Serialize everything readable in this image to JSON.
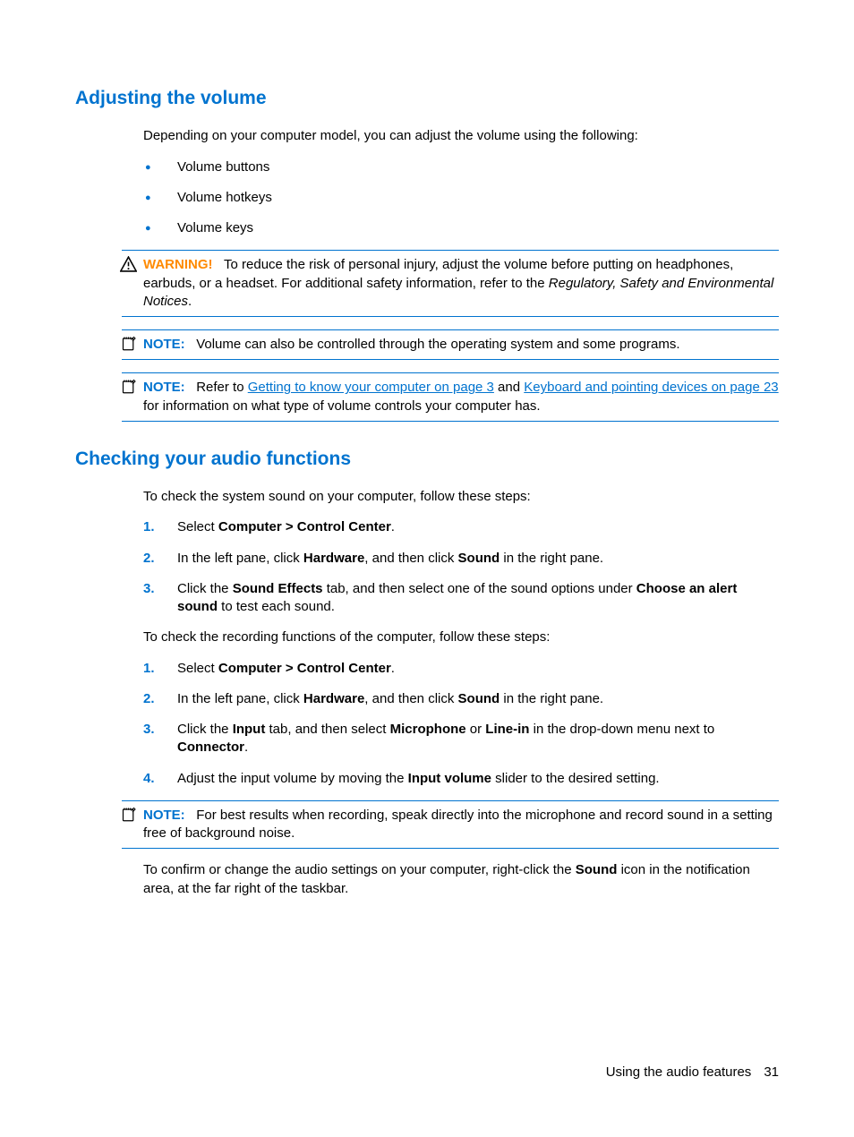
{
  "section1": {
    "heading": "Adjusting the volume",
    "intro": "Depending on your computer model, you can adjust the volume using the following:",
    "bullets": [
      "Volume buttons",
      "Volume hotkeys",
      "Volume keys"
    ],
    "warning": {
      "label": "WARNING!",
      "text_before_italic": "To reduce the risk of personal injury, adjust the volume before putting on headphones, earbuds, or a headset. For additional safety information, refer to the ",
      "italic": "Regulatory, Safety and Environmental Notices",
      "after_italic": "."
    },
    "note1": {
      "label": "NOTE:",
      "text": "Volume can also be controlled through the operating system and some programs."
    },
    "note2": {
      "label": "NOTE:",
      "pre": "Refer to ",
      "link1": "Getting to know your computer on page 3",
      "mid": " and ",
      "link2": "Keyboard and pointing devices on page 23",
      "post": " for information on what type of volume controls your computer has."
    }
  },
  "section2": {
    "heading": "Checking your audio functions",
    "intro": "To check the system sound on your computer, follow these steps:",
    "steps_a": {
      "s1_pre": "Select ",
      "s1_b": "Computer > Control Center",
      "s1_post": ".",
      "s2_pre": "In the left pane, click ",
      "s2_b1": "Hardware",
      "s2_mid": ", and then click ",
      "s2_b2": "Sound",
      "s2_post": " in the right pane.",
      "s3_pre": "Click the ",
      "s3_b1": "Sound Effects",
      "s3_mid": " tab, and then select one of the sound options under ",
      "s3_b2": "Choose an alert sound",
      "s3_post": " to test each sound."
    },
    "mid_para": "To check the recording functions of the computer, follow these steps:",
    "steps_b": {
      "s1_pre": "Select ",
      "s1_b": "Computer > Control Center",
      "s1_post": ".",
      "s2_pre": "In the left pane, click ",
      "s2_b1": "Hardware",
      "s2_mid": ", and then click ",
      "s2_b2": "Sound",
      "s2_post": " in the right pane.",
      "s3_pre": "Click the ",
      "s3_b1": "Input",
      "s3_mid1": " tab, and then select ",
      "s3_b2": "Microphone",
      "s3_mid2": " or ",
      "s3_b3": "Line-in",
      "s3_mid3": " in the drop-down menu next to ",
      "s3_b4": "Connector",
      "s3_post": ".",
      "s4_pre": "Adjust the input volume by moving the ",
      "s4_b": "Input volume",
      "s4_post": " slider to the desired setting."
    },
    "note3": {
      "label": "NOTE:",
      "text": "For best results when recording, speak directly into the microphone and record sound in a setting free of background noise."
    },
    "closing_pre": "To confirm or change the audio settings on your computer, right-click the ",
    "closing_b": "Sound",
    "closing_post": " icon in the notification area, at the far right of the taskbar."
  },
  "footer": {
    "section_label": "Using the audio features",
    "page_number": "31"
  }
}
